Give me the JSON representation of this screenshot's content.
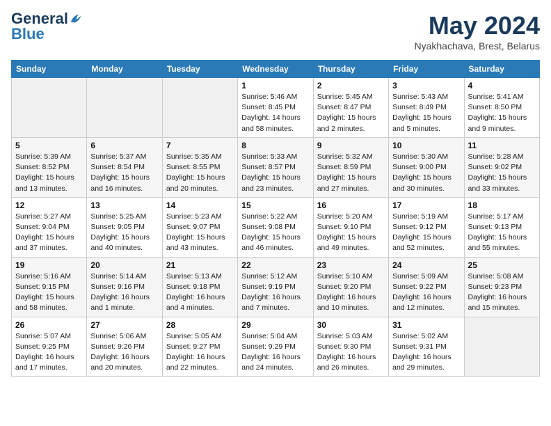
{
  "header": {
    "logo_general": "General",
    "logo_blue": "Blue",
    "title": "May 2024",
    "location": "Nyakhachava, Brest, Belarus"
  },
  "weekdays": [
    "Sunday",
    "Monday",
    "Tuesday",
    "Wednesday",
    "Thursday",
    "Friday",
    "Saturday"
  ],
  "weeks": [
    [
      {
        "day": "",
        "info": ""
      },
      {
        "day": "",
        "info": ""
      },
      {
        "day": "",
        "info": ""
      },
      {
        "day": "1",
        "info": "Sunrise: 5:46 AM\nSunset: 8:45 PM\nDaylight: 14 hours\nand 58 minutes."
      },
      {
        "day": "2",
        "info": "Sunrise: 5:45 AM\nSunset: 8:47 PM\nDaylight: 15 hours\nand 2 minutes."
      },
      {
        "day": "3",
        "info": "Sunrise: 5:43 AM\nSunset: 8:49 PM\nDaylight: 15 hours\nand 5 minutes."
      },
      {
        "day": "4",
        "info": "Sunrise: 5:41 AM\nSunset: 8:50 PM\nDaylight: 15 hours\nand 9 minutes."
      }
    ],
    [
      {
        "day": "5",
        "info": "Sunrise: 5:39 AM\nSunset: 8:52 PM\nDaylight: 15 hours\nand 13 minutes."
      },
      {
        "day": "6",
        "info": "Sunrise: 5:37 AM\nSunset: 8:54 PM\nDaylight: 15 hours\nand 16 minutes."
      },
      {
        "day": "7",
        "info": "Sunrise: 5:35 AM\nSunset: 8:55 PM\nDaylight: 15 hours\nand 20 minutes."
      },
      {
        "day": "8",
        "info": "Sunrise: 5:33 AM\nSunset: 8:57 PM\nDaylight: 15 hours\nand 23 minutes."
      },
      {
        "day": "9",
        "info": "Sunrise: 5:32 AM\nSunset: 8:59 PM\nDaylight: 15 hours\nand 27 minutes."
      },
      {
        "day": "10",
        "info": "Sunrise: 5:30 AM\nSunset: 9:00 PM\nDaylight: 15 hours\nand 30 minutes."
      },
      {
        "day": "11",
        "info": "Sunrise: 5:28 AM\nSunset: 9:02 PM\nDaylight: 15 hours\nand 33 minutes."
      }
    ],
    [
      {
        "day": "12",
        "info": "Sunrise: 5:27 AM\nSunset: 9:04 PM\nDaylight: 15 hours\nand 37 minutes."
      },
      {
        "day": "13",
        "info": "Sunrise: 5:25 AM\nSunset: 9:05 PM\nDaylight: 15 hours\nand 40 minutes."
      },
      {
        "day": "14",
        "info": "Sunrise: 5:23 AM\nSunset: 9:07 PM\nDaylight: 15 hours\nand 43 minutes."
      },
      {
        "day": "15",
        "info": "Sunrise: 5:22 AM\nSunset: 9:08 PM\nDaylight: 15 hours\nand 46 minutes."
      },
      {
        "day": "16",
        "info": "Sunrise: 5:20 AM\nSunset: 9:10 PM\nDaylight: 15 hours\nand 49 minutes."
      },
      {
        "day": "17",
        "info": "Sunrise: 5:19 AM\nSunset: 9:12 PM\nDaylight: 15 hours\nand 52 minutes."
      },
      {
        "day": "18",
        "info": "Sunrise: 5:17 AM\nSunset: 9:13 PM\nDaylight: 15 hours\nand 55 minutes."
      }
    ],
    [
      {
        "day": "19",
        "info": "Sunrise: 5:16 AM\nSunset: 9:15 PM\nDaylight: 15 hours\nand 58 minutes."
      },
      {
        "day": "20",
        "info": "Sunrise: 5:14 AM\nSunset: 9:16 PM\nDaylight: 16 hours\nand 1 minute."
      },
      {
        "day": "21",
        "info": "Sunrise: 5:13 AM\nSunset: 9:18 PM\nDaylight: 16 hours\nand 4 minutes."
      },
      {
        "day": "22",
        "info": "Sunrise: 5:12 AM\nSunset: 9:19 PM\nDaylight: 16 hours\nand 7 minutes."
      },
      {
        "day": "23",
        "info": "Sunrise: 5:10 AM\nSunset: 9:20 PM\nDaylight: 16 hours\nand 10 minutes."
      },
      {
        "day": "24",
        "info": "Sunrise: 5:09 AM\nSunset: 9:22 PM\nDaylight: 16 hours\nand 12 minutes."
      },
      {
        "day": "25",
        "info": "Sunrise: 5:08 AM\nSunset: 9:23 PM\nDaylight: 16 hours\nand 15 minutes."
      }
    ],
    [
      {
        "day": "26",
        "info": "Sunrise: 5:07 AM\nSunset: 9:25 PM\nDaylight: 16 hours\nand 17 minutes."
      },
      {
        "day": "27",
        "info": "Sunrise: 5:06 AM\nSunset: 9:26 PM\nDaylight: 16 hours\nand 20 minutes."
      },
      {
        "day": "28",
        "info": "Sunrise: 5:05 AM\nSunset: 9:27 PM\nDaylight: 16 hours\nand 22 minutes."
      },
      {
        "day": "29",
        "info": "Sunrise: 5:04 AM\nSunset: 9:29 PM\nDaylight: 16 hours\nand 24 minutes."
      },
      {
        "day": "30",
        "info": "Sunrise: 5:03 AM\nSunset: 9:30 PM\nDaylight: 16 hours\nand 26 minutes."
      },
      {
        "day": "31",
        "info": "Sunrise: 5:02 AM\nSunset: 9:31 PM\nDaylight: 16 hours\nand 29 minutes."
      },
      {
        "day": "",
        "info": ""
      }
    ]
  ]
}
